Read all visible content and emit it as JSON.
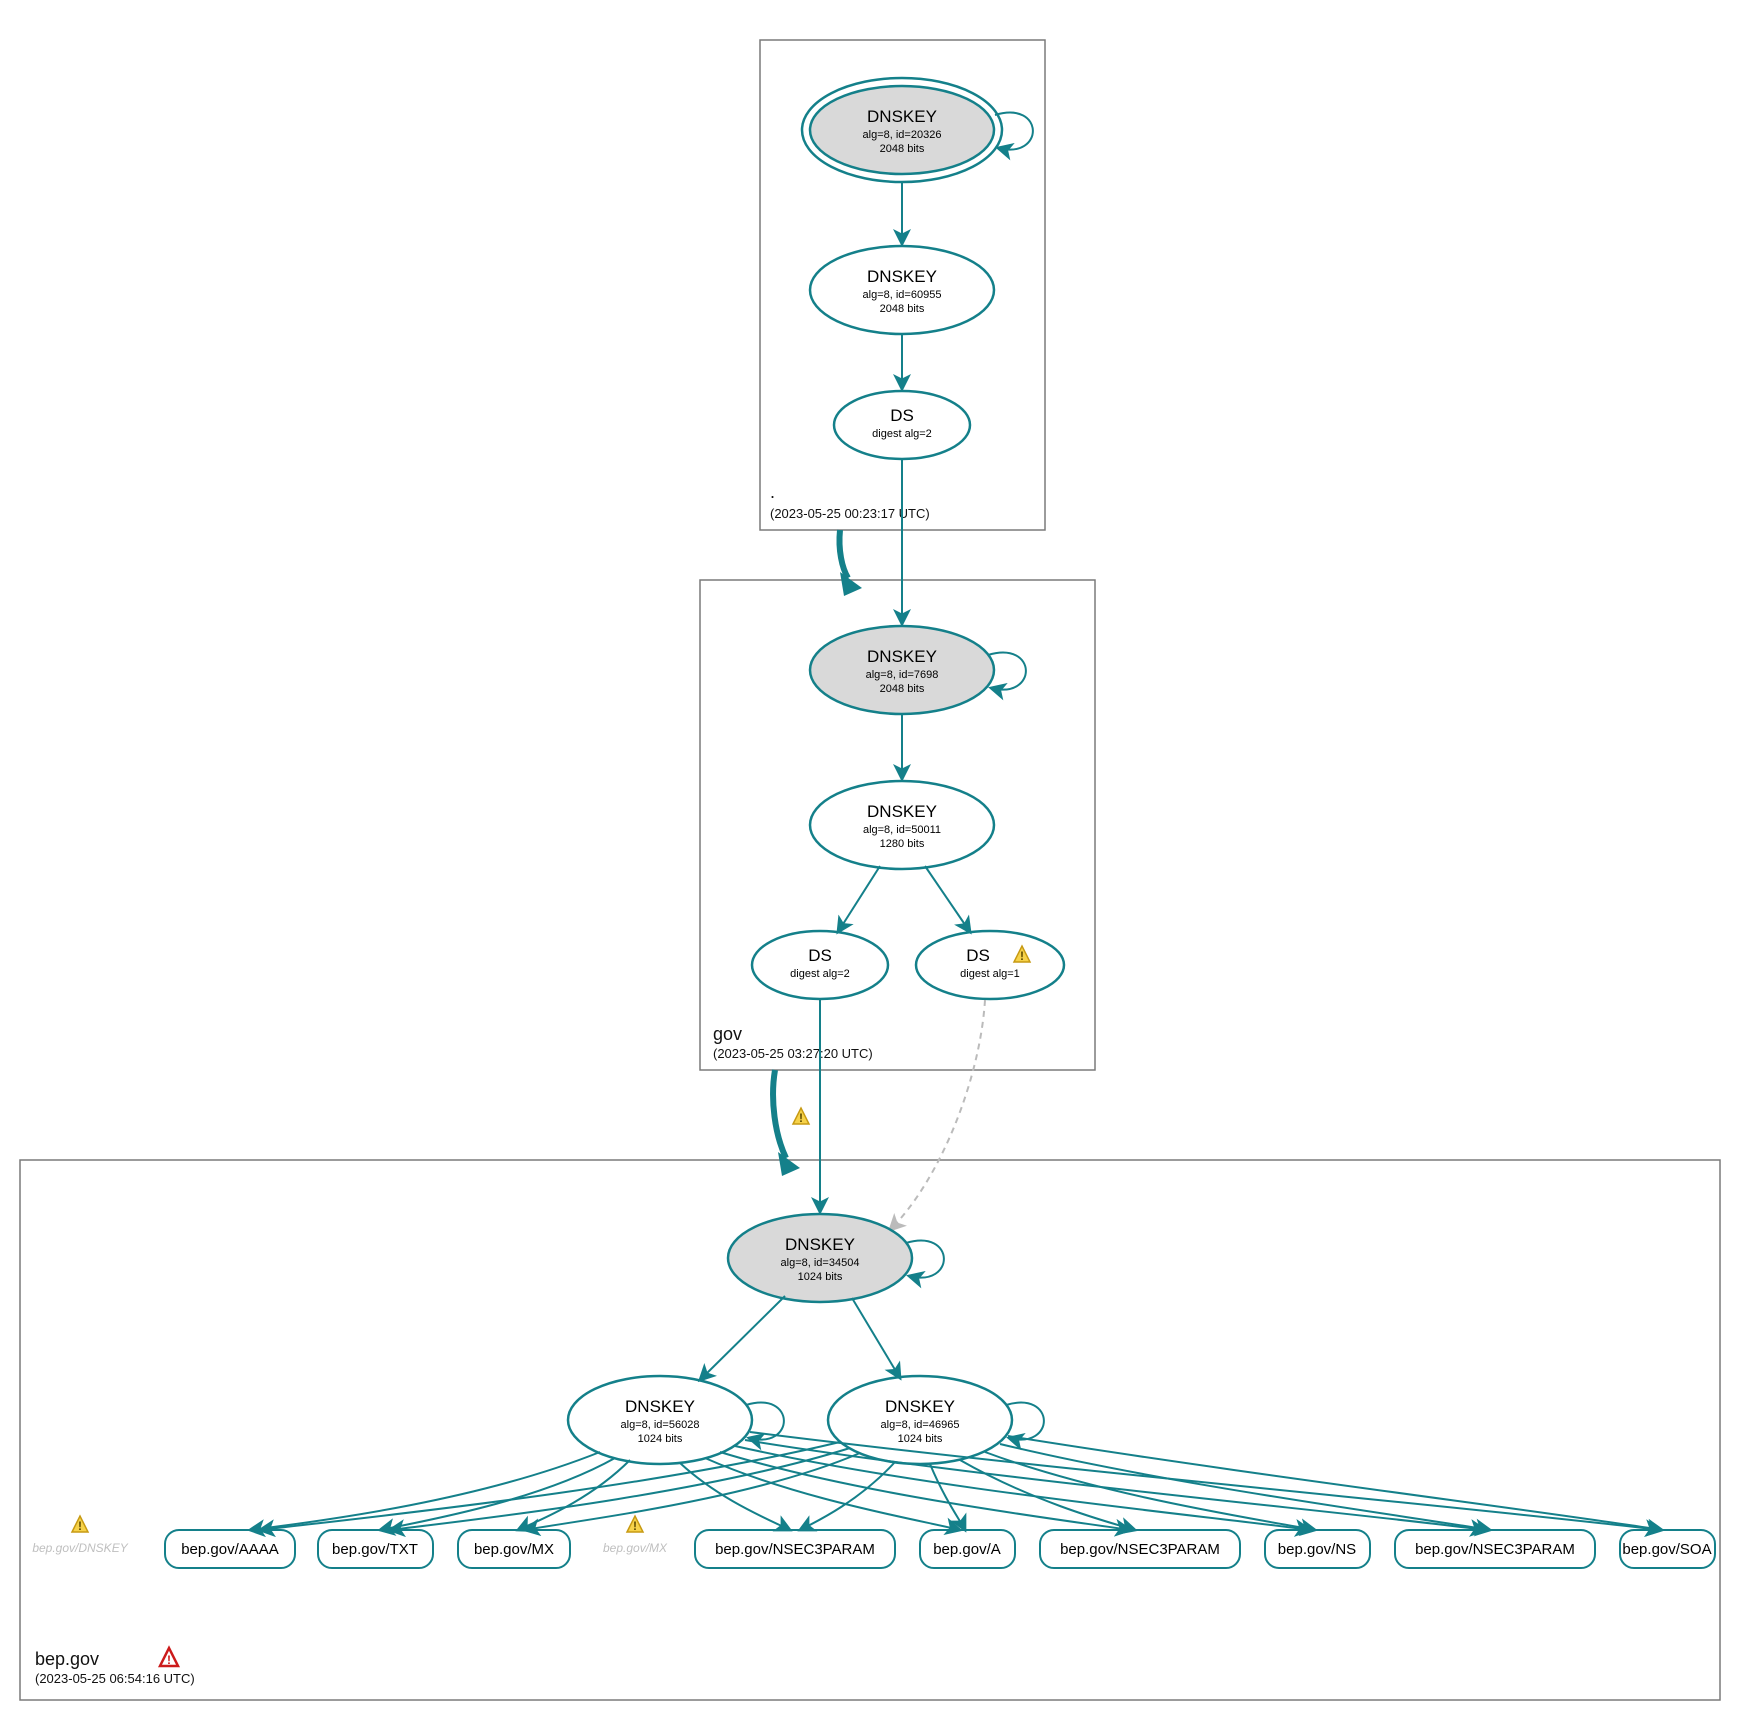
{
  "colors": {
    "accent": "#14808a",
    "ksk_fill": "#d9d9d9",
    "warn": "#f6d24a",
    "error": "#cc1b1b"
  },
  "zones": {
    "root": {
      "label": ".",
      "timestamp": "(2023-05-25 00:23:17 UTC)"
    },
    "gov": {
      "label": "gov",
      "timestamp": "(2023-05-25 03:27:20 UTC)"
    },
    "bep": {
      "label": "bep.gov",
      "timestamp": "(2023-05-25 06:54:16 UTC)"
    }
  },
  "nodes": {
    "root_ksk": {
      "title": "DNSKEY",
      "sub1": "alg=8, id=20326",
      "sub2": "2048 bits"
    },
    "root_zsk": {
      "title": "DNSKEY",
      "sub1": "alg=8, id=60955",
      "sub2": "2048 bits"
    },
    "root_ds": {
      "title": "DS",
      "sub1": "digest alg=2"
    },
    "gov_ksk": {
      "title": "DNSKEY",
      "sub1": "alg=8, id=7698",
      "sub2": "2048 bits"
    },
    "gov_zsk": {
      "title": "DNSKEY",
      "sub1": "alg=8, id=50011",
      "sub2": "1280 bits"
    },
    "gov_ds1": {
      "title": "DS",
      "sub1": "digest alg=2"
    },
    "gov_ds2": {
      "title": "DS",
      "sub1": "digest alg=1"
    },
    "bep_ksk": {
      "title": "DNSKEY",
      "sub1": "alg=8, id=34504",
      "sub2": "1024 bits"
    },
    "bep_zsk1": {
      "title": "DNSKEY",
      "sub1": "alg=8, id=56028",
      "sub2": "1024 bits"
    },
    "bep_zsk2": {
      "title": "DNSKEY",
      "sub1": "alg=8, id=46965",
      "sub2": "1024 bits"
    }
  },
  "records": {
    "r1": "bep.gov/AAAA",
    "r2": "bep.gov/TXT",
    "r3": "bep.gov/MX",
    "r4": "bep.gov/NSEC3PARAM",
    "r5": "bep.gov/A",
    "r6": "bep.gov/NSEC3PARAM",
    "r7": "bep.gov/NS",
    "r8": "bep.gov/NSEC3PARAM",
    "r9": "bep.gov/SOA"
  },
  "ghosts": {
    "g1": "bep.gov/DNSKEY",
    "g2": "bep.gov/MX"
  }
}
